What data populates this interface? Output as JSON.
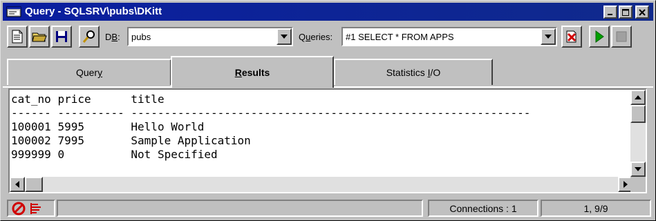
{
  "window": {
    "title": "Query - SQLSRV\\pubs\\DKitt"
  },
  "title_buttons": {
    "minimize": "_",
    "maximize": "□",
    "close": "✕"
  },
  "toolbar": {
    "db_label_prefix": "D",
    "db_label_underlined": "B",
    "db_label_suffix": ":",
    "db_value": "pubs",
    "queries_label_prefix": "Q",
    "queries_label_underlined": "u",
    "queries_label_suffix": "eries:",
    "queries_value": "#1 SELECT * FROM APPS",
    "icons": [
      "new-query-icon",
      "open-folder-icon",
      "save-icon",
      "find-icon",
      "remove-query-icon",
      "execute-icon",
      "stop-icon"
    ]
  },
  "tabs": {
    "query_prefix": "Quer",
    "query_underlined": "y",
    "results_prefix": "",
    "results_underlined": "R",
    "results_suffix": "esults",
    "statistics_prefix": "Statistics ",
    "statistics_underlined": "I",
    "statistics_suffix": "/O",
    "active": "Results"
  },
  "results": {
    "headers": [
      "cat_no",
      "price",
      "title"
    ],
    "rows": [
      [
        "100001",
        "5995",
        "Hello World"
      ],
      [
        "100002",
        "7995",
        "Sample Application"
      ],
      [
        "999999",
        "0",
        "Not Specified"
      ]
    ]
  },
  "status": {
    "connections": "Connections : 1",
    "position": "1, 9/9",
    "icons": [
      "stop-sign-icon",
      "results-grid-icon"
    ]
  },
  "colors": {
    "titlebar": "#0a1ea0",
    "face": "#c0c0c0",
    "execute": "#00a000",
    "stop_sign": "#d00000"
  }
}
